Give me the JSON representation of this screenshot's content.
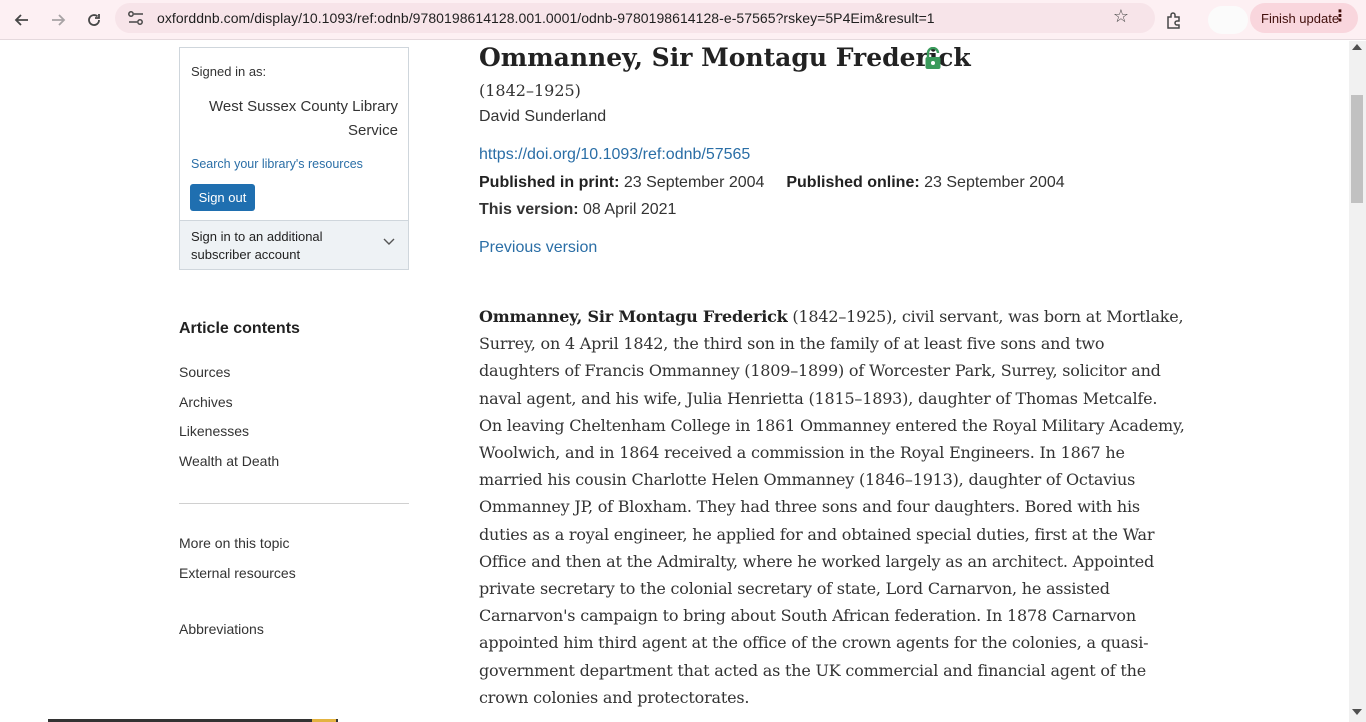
{
  "browser": {
    "url": "oxforddnb.com/display/10.1093/ref:odnb/9780198614128.001.0001/odnb-9780198614128-e-57565?rskey=5P4Eim&result=1",
    "update_button": "Finish update"
  },
  "sidebar": {
    "signed_in_label": "Signed in as:",
    "library_name": "West Sussex County Library Service",
    "library_link": "Search your library's resources",
    "sign_out": "Sign out",
    "additional_account": "Sign in to an additional subscriber account",
    "contents_title": "Article contents",
    "toc": [
      "Sources",
      "Archives",
      "Likenesses",
      "Wealth at Death"
    ],
    "more_links": [
      "More on this topic",
      "External resources"
    ],
    "abbreviations": "Abbreviations"
  },
  "article": {
    "title": "Ommanney, Sir Montagu Frederick",
    "dates": "(1842–1925)",
    "author": "David Sunderland",
    "doi": "https://doi.org/10.1093/ref:odnb/57565",
    "published_print_label": "Published in print:",
    "published_print": "23 September 2004",
    "published_online_label": "Published online:",
    "published_online": "23 September 2004",
    "version_label": "This version:",
    "version_date": "08 April 2021",
    "previous_version": "Previous version",
    "body_lead": "Ommanney, Sir Montagu Frederick",
    "body_lines": [
      " (1842–1925), civil servant, was born at Mortlake,",
      "Surrey, on 4 April 1842, the third son in the family of at least five sons and two",
      "daughters of Francis Ommanney (1809–1899) of Worcester Park, Surrey, solicitor and",
      "naval agent, and his wife, Julia Henrietta (1815–1893), daughter of Thomas Metcalfe.",
      "On leaving Cheltenham College in 1861 Ommanney entered the Royal Military Academy,",
      "Woolwich, and in 1864 received a commission in the Royal Engineers. In 1867 he",
      "married his cousin Charlotte Helen Ommanney (1846–1913), daughter of Octavius",
      "Ommanney JP, of Bloxham. They had three sons and four daughters. Bored with his",
      "duties as a royal engineer, he applied for and obtained special duties, first at the War",
      "Office and then at the Admiralty, where he worked largely as an architect. Appointed",
      "private secretary to the colonial secretary of state, Lord Carnarvon, he assisted",
      "Carnarvon's campaign to bring about South African federation. In 1878 Carnarvon",
      "appointed him third agent at the office of the crown agents for the colonies, a quasi-",
      "government department that acted as the UK commercial and financial agent of the",
      "crown colonies and protectorates."
    ]
  }
}
